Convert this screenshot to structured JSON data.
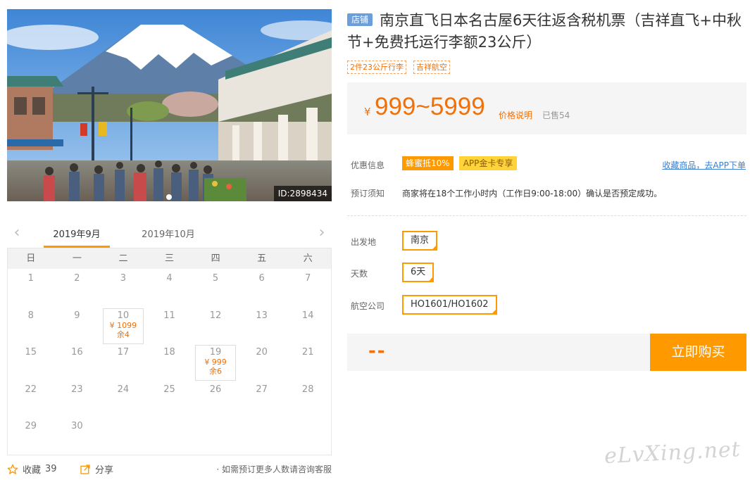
{
  "hero": {
    "id_label": "ID:2898434"
  },
  "calendar": {
    "tabs": [
      "2019年9月",
      "2019年10月"
    ],
    "prev_label": "‹",
    "next_label": "›",
    "weekdays": [
      "日",
      "一",
      "二",
      "三",
      "四",
      "五",
      "六"
    ],
    "days": [
      {
        "day": "1"
      },
      {
        "day": "2"
      },
      {
        "day": "3"
      },
      {
        "day": "4"
      },
      {
        "day": "5"
      },
      {
        "day": "6"
      },
      {
        "day": "7"
      },
      {
        "day": "8"
      },
      {
        "day": "9"
      },
      {
        "day": "10",
        "price": "¥ 1099",
        "stock": "余4"
      },
      {
        "day": "11"
      },
      {
        "day": "12"
      },
      {
        "day": "13"
      },
      {
        "day": "14"
      },
      {
        "day": "15"
      },
      {
        "day": "16"
      },
      {
        "day": "17"
      },
      {
        "day": "18"
      },
      {
        "day": "19",
        "price": "¥ 999",
        "stock": "余6"
      },
      {
        "day": "20"
      },
      {
        "day": "21"
      },
      {
        "day": "22"
      },
      {
        "day": "23"
      },
      {
        "day": "24"
      },
      {
        "day": "25"
      },
      {
        "day": "26"
      },
      {
        "day": "27"
      },
      {
        "day": "28"
      },
      {
        "day": "29"
      },
      {
        "day": "30"
      }
    ]
  },
  "actions": {
    "favorite_label": "收藏",
    "favorite_count": "39",
    "share_label": "分享",
    "consult_text": "· 如需预订更多人数请咨询客服"
  },
  "product": {
    "shop_tag": "店铺",
    "title": "南京直飞日本名古屋6天往返含税机票（吉祥直飞+中秋节+免费托运行李额23公斤）",
    "tags": [
      "2件23公斤行李",
      "吉祥航空"
    ],
    "price_currency": "¥",
    "price_range": "999~5999",
    "price_note": "价格说明",
    "sold": "已售54"
  },
  "promo": {
    "label": "优惠信息",
    "discount_1": "蜂蜜抵10%",
    "discount_2": "APP金卡专享",
    "app_link": "收藏商品，去APP下单"
  },
  "booking": {
    "label": "预订须知",
    "notice": "商家将在18个工作小时内（工作日9:00-18:00）确认是否预定成功。"
  },
  "options": {
    "departure_label": "出发地",
    "departure_value": "南京",
    "days_label": "天数",
    "days_value": "6天",
    "airline_label": "航空公司",
    "airline_value": "HO1601/HO1602"
  },
  "buy": {
    "price_placeholder": "--",
    "button_label": "立即购买"
  },
  "watermark": "eLvXing.net",
  "colors": {
    "accent": "#ff9900",
    "price": "#f0700a",
    "link": "#3a7fd0",
    "shop_tag": "#6c9fd9"
  }
}
